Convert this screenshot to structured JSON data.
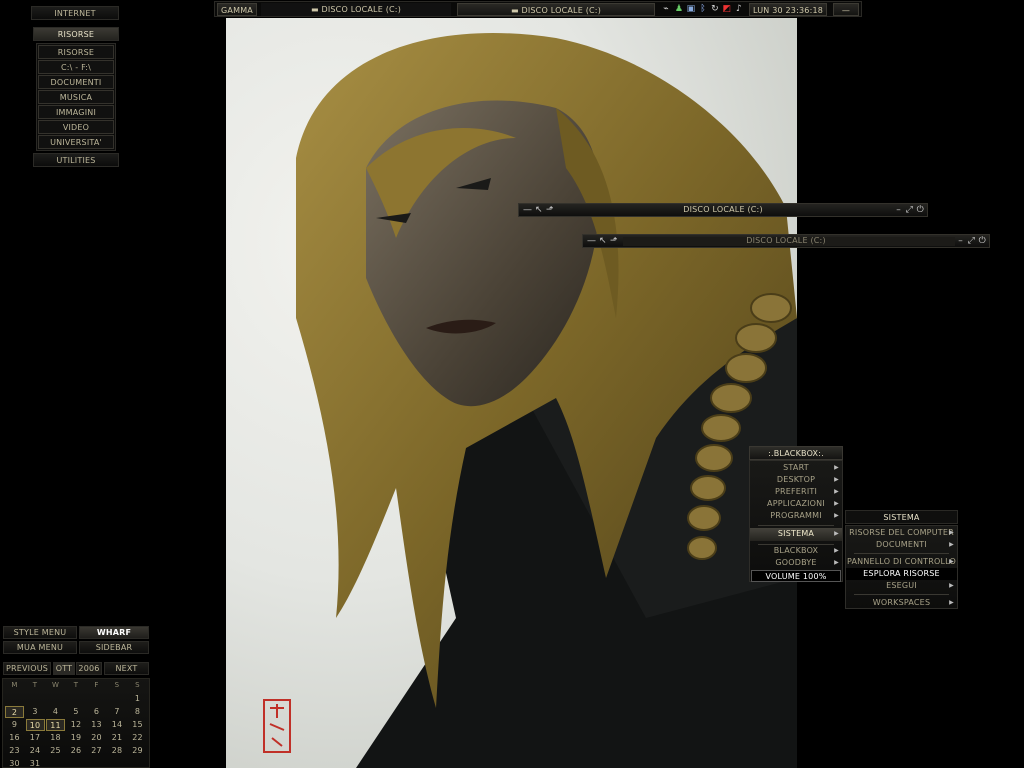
{
  "sidebar": {
    "internet": "INTERNET",
    "risorse": "RISORSE",
    "items": [
      "RISORSE",
      "C:\\ - F:\\",
      "DOCUMENTI",
      "MUSICA",
      "IMMAGINI",
      "VIDEO",
      "UNIVERSITA'"
    ],
    "utilities": "UTILITIES"
  },
  "topbar": {
    "workspace": "GAMMA",
    "task1": "DISCO LOCALE (C:)",
    "task2": "DISCO LOCALE (C:)",
    "clock": "LUN 30 23:36:18",
    "min": "—"
  },
  "windows": [
    {
      "title": "DISCO LOCALE (C:)"
    },
    {
      "title": "DISCO LOCALE (C:)"
    }
  ],
  "blackbox": {
    "title": ":.BLACKBOX:.",
    "items": [
      "START",
      "DESKTOP",
      "PREFERITI",
      "APPLICAZIONI",
      "PROGRAMMI"
    ],
    "sistema": "SISTEMA",
    "items2": [
      "BLACKBOX",
      "GOODBYE"
    ],
    "volume": "VOLUME 100%"
  },
  "sistema_menu": {
    "title": "SISTEMA",
    "items": [
      "RISORSE DEL COMPUTER",
      "DOCUMENTI",
      "PANNELLO DI CONTROLLO",
      "ESPLORA RISORSE",
      "ESEGUI",
      "WORKSPACES"
    ]
  },
  "panel": {
    "style_menu": "STYLE MENU",
    "wharf": "WHARF",
    "mua_menu": "MUA MENU",
    "sidebar": "SIDEBAR",
    "previous": "PREVIOUS",
    "month": "OTT",
    "year": "2006",
    "next": "NEXT"
  },
  "calendar": {
    "weekdays": [
      "M",
      "T",
      "W",
      "T",
      "F",
      "S",
      "S"
    ],
    "weeks": [
      [
        "",
        "",
        "",
        "",
        "",
        "",
        "1"
      ],
      [
        "2",
        "3",
        "4",
        "5",
        "6",
        "7",
        "8"
      ],
      [
        "9",
        "10",
        "11",
        "12",
        "13",
        "14",
        "15"
      ],
      [
        "16",
        "17",
        "18",
        "19",
        "20",
        "21",
        "22"
      ],
      [
        "23",
        "24",
        "25",
        "26",
        "27",
        "28",
        "29"
      ],
      [
        "30",
        "31",
        "",
        "",
        "",
        "",
        ""
      ]
    ],
    "highlighted": [
      "2",
      "10",
      "11"
    ]
  },
  "colors": {
    "accent": "#c8c0a0",
    "hair": "#8a7430",
    "background": "#000000"
  },
  "icons": [
    "network-icon",
    "user-icon",
    "monitor-icon",
    "bluetooth-icon",
    "refresh-icon",
    "antivirus-icon",
    "speaker-icon"
  ]
}
